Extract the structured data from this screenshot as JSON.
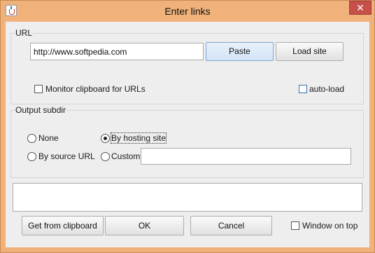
{
  "window": {
    "title": "Enter links",
    "close_label": "✕"
  },
  "url_group": {
    "legend": "URL",
    "url_value": "http://www.softpedia.com",
    "paste_label": "Paste",
    "load_site_label": "Load site",
    "monitor_label": "Monitor clipboard for URLs",
    "monitor_checked": false,
    "autoload_label": "auto-load",
    "autoload_checked": false
  },
  "subdir_group": {
    "legend": "Output subdir",
    "options": [
      {
        "label": "None",
        "checked": false
      },
      {
        "label": "By hosting site",
        "checked": true
      },
      {
        "label": "By source URL",
        "checked": false
      },
      {
        "label": "Custom",
        "checked": false
      }
    ],
    "custom_value": ""
  },
  "links_area": {
    "value": ""
  },
  "bottom": {
    "get_clipboard_label": "Get from clipboard",
    "ok_label": "OK",
    "cancel_label": "Cancel",
    "window_on_top_label": "Window on top",
    "window_on_top_checked": false
  }
}
